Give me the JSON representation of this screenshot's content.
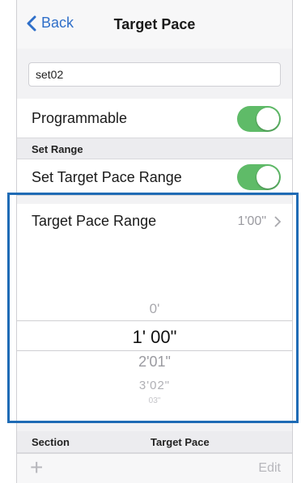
{
  "nav": {
    "back_label": "Back",
    "title": "Target Pace"
  },
  "set_name": {
    "value": "set02"
  },
  "programmable": {
    "label": "Programmable",
    "on": true
  },
  "set_range_header": "Set Range",
  "set_target_pace_range": {
    "label": "Set Target Pace Range",
    "on": true
  },
  "target_pace_range": {
    "label": "Target Pace Range",
    "value": "1'00\""
  },
  "picker": {
    "above": "0'",
    "selected": "1'  00\"",
    "below": [
      "2'01\"",
      "3'02\"",
      "03\""
    ]
  },
  "table_header": {
    "section": "Section",
    "target_pace": "Target Pace"
  },
  "bottom": {
    "add_icon": "+",
    "edit_label": "Edit"
  },
  "colors": {
    "accent": "#2f6fc9",
    "toggle_on": "#5fbb68",
    "highlight": "#1f6bb5"
  }
}
